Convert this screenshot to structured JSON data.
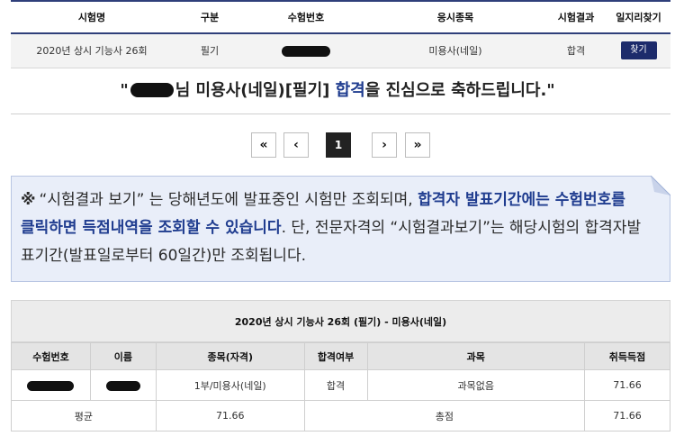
{
  "results_table": {
    "headers": [
      "시험명",
      "구분",
      "수험번호",
      "응시종목",
      "시험결과",
      "일지리찾기"
    ],
    "row": {
      "exam_name": "2020년 상시 기능사 26회",
      "category": "필기",
      "exam_subject": "미용사(네일)",
      "result": "합격",
      "find_button": "찾기"
    }
  },
  "congrats": {
    "quote_open": "\"",
    "pre": "님 미용사(네일)[필기] ",
    "highlight": "합격",
    "post": "을 진심으로 축하드립니다.\""
  },
  "pagination": {
    "first": "«",
    "prev": "‹",
    "current": "1",
    "next": "›",
    "last": "»"
  },
  "notice": {
    "mark": "※",
    "part1": "“시험결과 보기” 는 당해년도에 발표중인 시험만 조회되며, ",
    "highlight": "합격자 발표기간에는 수험번호를 클릭하면 득점내역을 조회할 수 있습니다",
    "part2": ". 단, 전문자격의 “시험결과보기”는 해당시험의 합격자발표기간(발표일로부터 60일간)만 조회됩니다."
  },
  "score_table": {
    "title": "2020년 상시 기능사 26회 (필기) - 미용사(네일)",
    "headers": [
      "수험번호",
      "이름",
      "종목(자격)",
      "합격여부",
      "과목",
      "취득득점"
    ],
    "row": {
      "subject": "1부/미용사(네일)",
      "pass": "합격",
      "course": "과목없음",
      "score": "71.66"
    },
    "footer": {
      "avg_label": "평균",
      "avg_value": "71.66",
      "total_label": "총점",
      "total_value": "71.66"
    }
  },
  "colors": {
    "accent": "#1f3c8f",
    "button": "#1d2b6b",
    "notice_bg": "#e9eef9"
  }
}
